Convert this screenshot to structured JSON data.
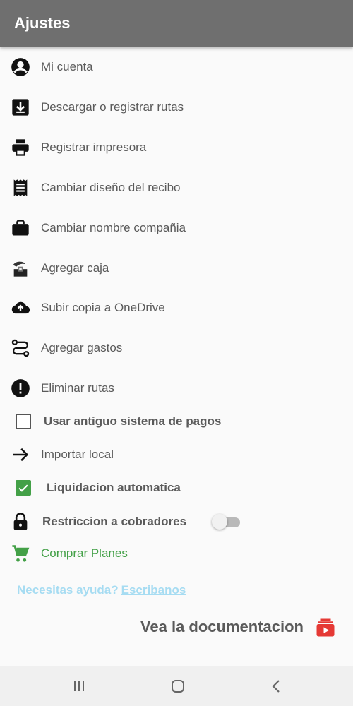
{
  "appbar": {
    "title": "Ajustes"
  },
  "menu": [
    {
      "label": "Mi cuenta",
      "icon": "account-circle-icon"
    },
    {
      "label": "Descargar o registrar rutas",
      "icon": "download-box-icon"
    },
    {
      "label": "Registrar impresora",
      "icon": "printer-icon"
    },
    {
      "label": "Cambiar diseño del recibo",
      "icon": "receipt-icon"
    },
    {
      "label": "Cambiar nombre compañia",
      "icon": "briefcase-icon"
    },
    {
      "label": "Agregar caja",
      "icon": "cash-box-icon"
    },
    {
      "label": "Subir copia a OneDrive",
      "icon": "cloud-upload-icon"
    },
    {
      "label": "Agregar gastos",
      "icon": "route-settings-icon"
    },
    {
      "label": "Eliminar rutas",
      "icon": "alert-circle-icon"
    },
    {
      "label": "Usar antiguo sistema de pagos",
      "icon": "checkbox-icon",
      "checked": false
    },
    {
      "label": "Importar local",
      "icon": "arrow-right-icon"
    },
    {
      "label": "Liquidacion automatica",
      "icon": "checkbox-icon",
      "checked": true
    },
    {
      "label": "Restriccion a cobradores",
      "icon": "lock-icon",
      "toggle": false
    },
    {
      "label": "Comprar Planes",
      "icon": "cart-icon"
    }
  ],
  "help": {
    "text": "Necesitas ayuda?",
    "link": "Escribanos"
  },
  "docs": {
    "label": "Vea la documentacion",
    "icon": "video-library-icon"
  },
  "colors": {
    "appbar": "#6f6f6f",
    "green": "#43a047",
    "help": "#a6dcf2",
    "docs_icon": "#e53935"
  }
}
